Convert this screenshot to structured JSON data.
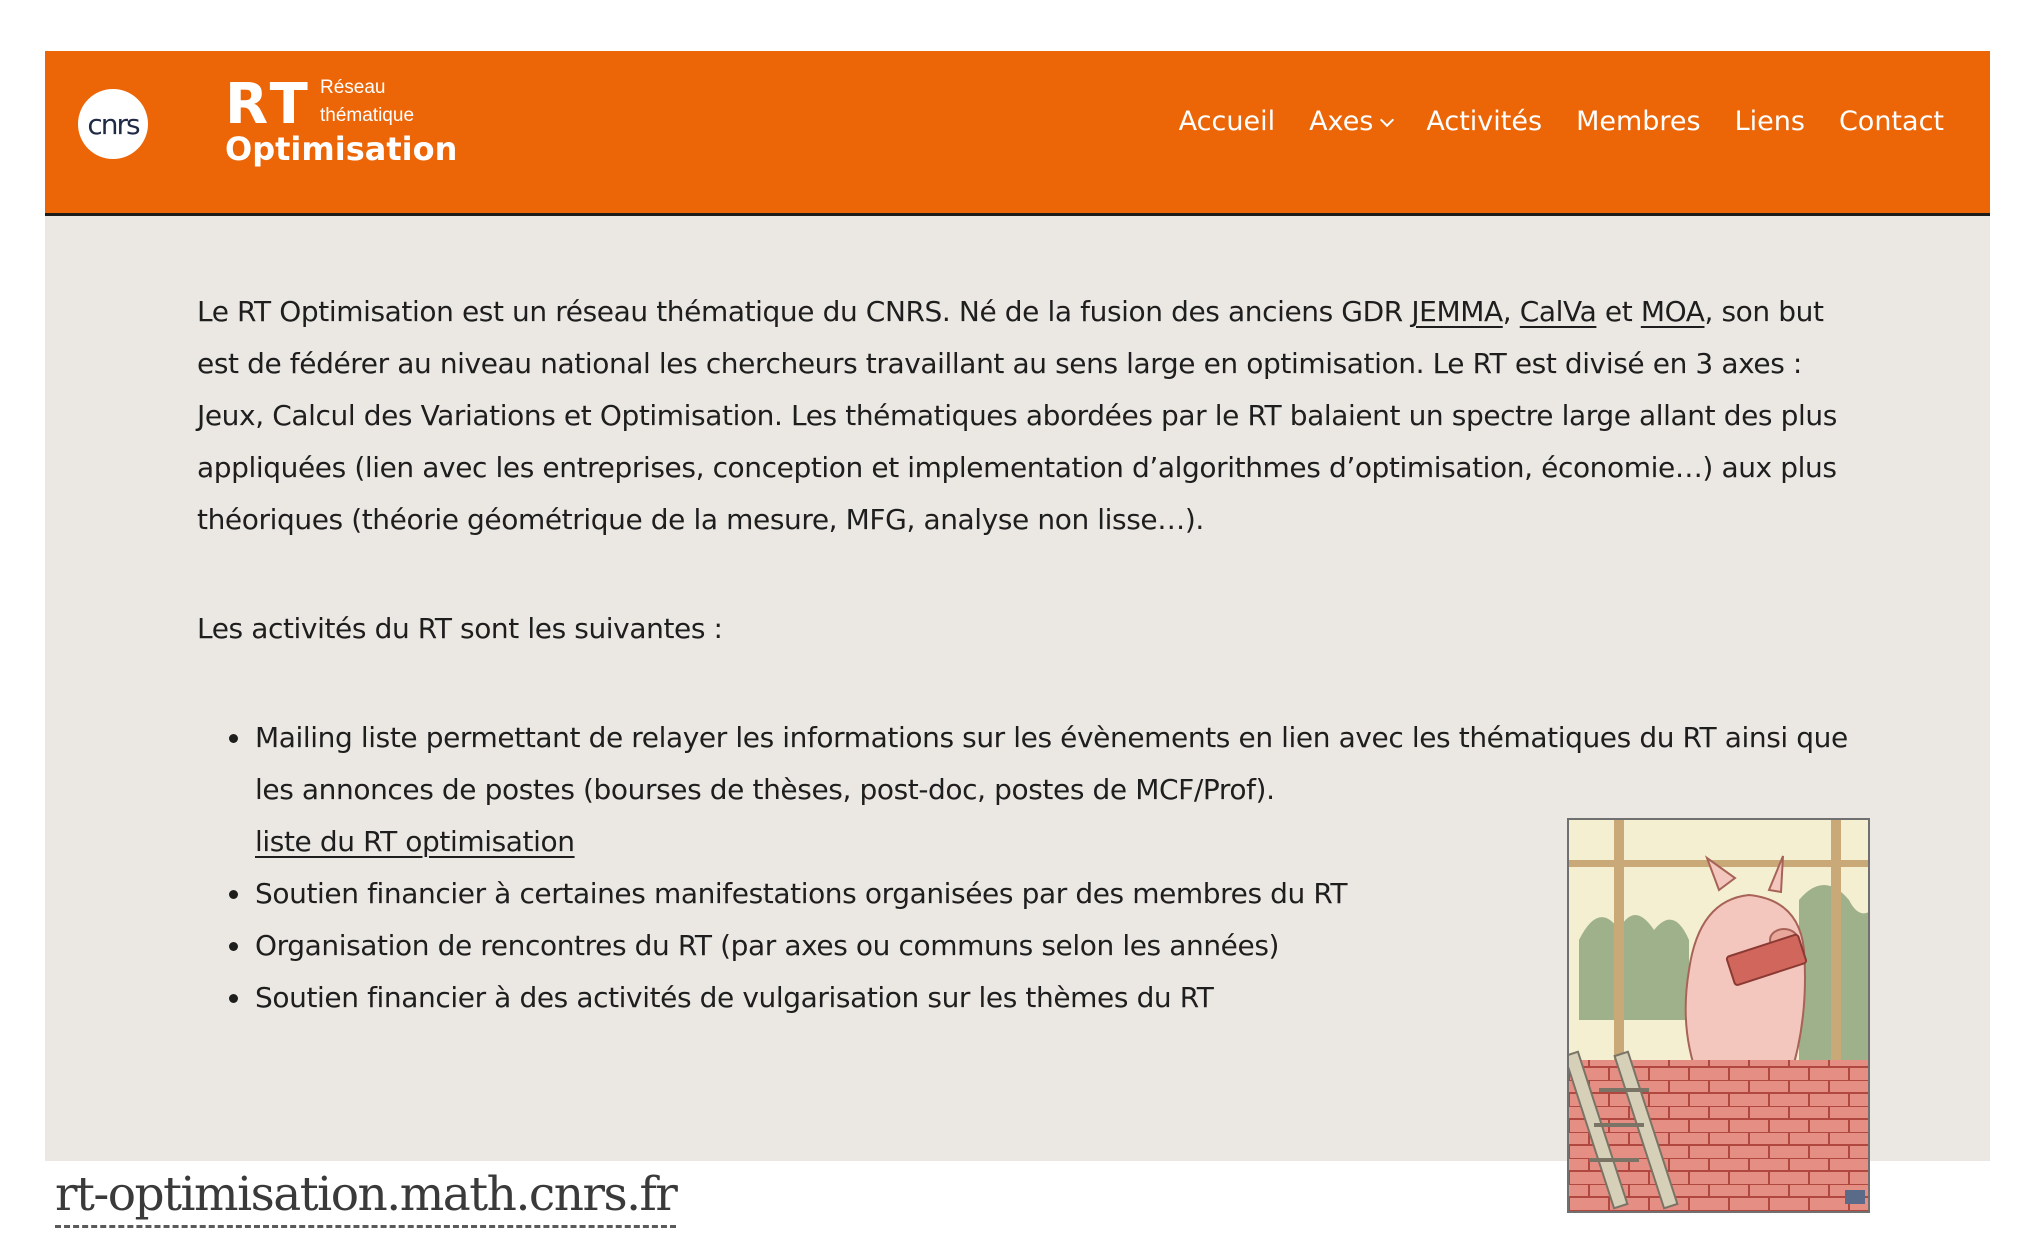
{
  "header": {
    "cnrs_logo_text": "cnrs",
    "rt_logo": {
      "mark": "RT",
      "line1": "Réseau",
      "line2": "thématique",
      "name": "Optimisation"
    },
    "nav": {
      "items": [
        {
          "label": "Accueil"
        },
        {
          "label": "Axes",
          "has_dropdown": true
        },
        {
          "label": "Activités"
        },
        {
          "label": "Membres"
        },
        {
          "label": "Liens"
        },
        {
          "label": "Contact"
        }
      ]
    },
    "colors": {
      "header_bg": "#ec6608",
      "page_bg": "#ebe8e3"
    }
  },
  "intro": {
    "t1": "Le RT Optimisation est un réseau thématique du CNRS. Né de la fusion des anciens GDR ",
    "link_jemma": "JEMMA",
    "sep1": ", ",
    "link_calva": "CalVa",
    "t2": " et ",
    "link_moa": "MOA",
    "t3": ", son but est de fédérer au niveau national les chercheurs travaillant au sens large en optimisation. Le RT est divisé en 3 axes : Jeux, Calcul des Variations et Optimisation. Les thématiques abordées par le RT balaient un spectre large allant des plus appliquées (lien avec les entreprises, conception et implementation d’algorithmes d’optimisation, économie…) aux plus théoriques (théorie géométrique de la mesure, MFG, analyse non lisse…)."
  },
  "activities": {
    "heading": "Les activités du RT sont les suivantes :",
    "item1_text": "Mailing liste permettant de relayer les informations sur les évènements en lien avec les thématiques du RT ainsi que les annonces de postes (bourses de thèses, post-doc, postes de MCF/Prof).",
    "item1_link": "liste du RT optimisation",
    "item2": "Soutien financier à certaines manifestations organisées par des membres du RT",
    "item3": "Organisation de rencontres du RT (par axes ou communs selon les années)",
    "item4": "Soutien financier à des activités de vulgarisation sur les thèmes du RT"
  },
  "illustration": {
    "icon": "pig-bricklayer-illustration"
  },
  "footer_url": "rt-optimisation.math.cnrs.fr"
}
